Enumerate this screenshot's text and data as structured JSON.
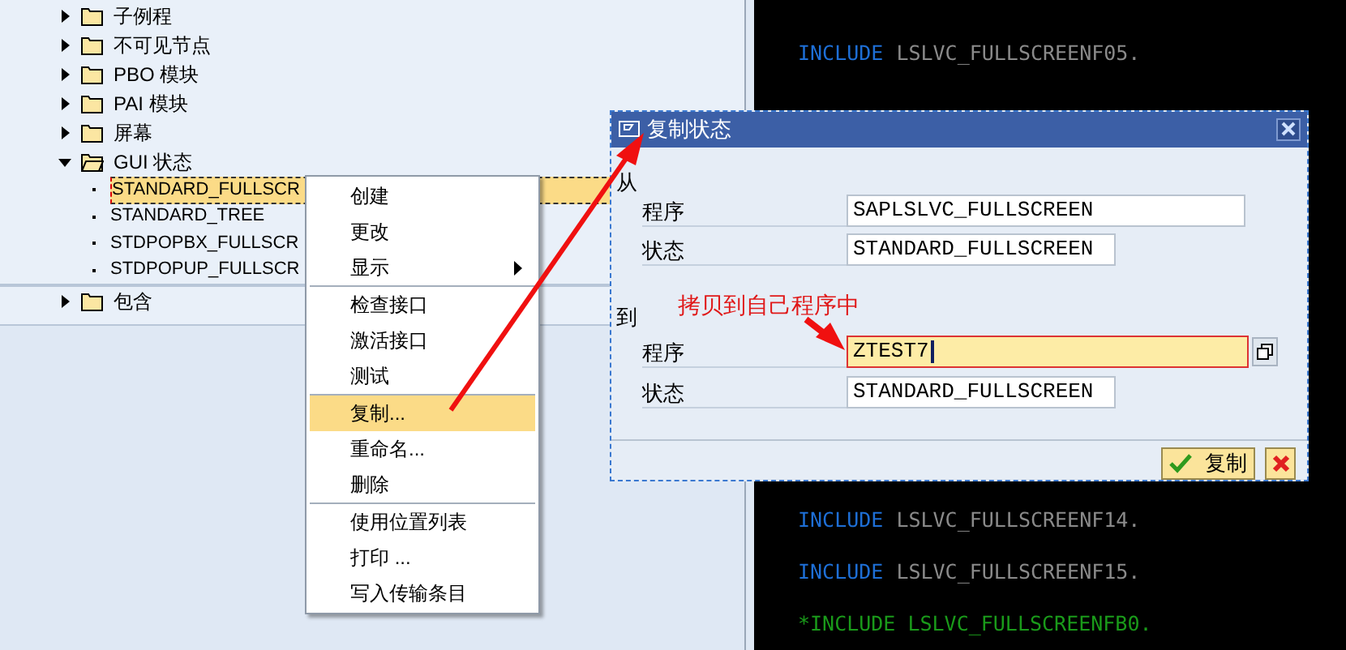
{
  "tree": {
    "items": [
      {
        "label": "子例程",
        "expanded": false
      },
      {
        "label": "不可见节点",
        "expanded": false
      },
      {
        "label": "PBO 模块",
        "expanded": false
      },
      {
        "label": "PAI 模块",
        "expanded": false
      },
      {
        "label": "屏幕",
        "expanded": false
      },
      {
        "label": "GUI 状态",
        "expanded": true,
        "children": [
          {
            "label": "STANDARD_FULLSCR",
            "selected": true
          },
          {
            "label": "STANDARD_TREE",
            "selected": false
          },
          {
            "label": "STDPOPBX_FULLSCR",
            "selected": false
          },
          {
            "label": "STDPOPUP_FULLSCR",
            "selected": false
          }
        ]
      },
      {
        "label": "包含",
        "expanded": false
      }
    ]
  },
  "context_menu": {
    "groups": [
      [
        {
          "label": "创建",
          "selected": false,
          "submenu": false
        },
        {
          "label": "更改",
          "selected": false,
          "submenu": false
        },
        {
          "label": "显示",
          "selected": false,
          "submenu": true
        }
      ],
      [
        {
          "label": "检查接口",
          "selected": false,
          "submenu": false
        },
        {
          "label": "激活接口",
          "selected": false,
          "submenu": false
        },
        {
          "label": "测试",
          "selected": false,
          "submenu": false
        }
      ],
      [
        {
          "label": "复制...",
          "selected": true,
          "submenu": false
        },
        {
          "label": "重命名...",
          "selected": false,
          "submenu": false
        },
        {
          "label": "删除",
          "selected": false,
          "submenu": false
        }
      ],
      [
        {
          "label": "使用位置列表",
          "selected": false,
          "submenu": false
        },
        {
          "label": "打印 ...",
          "selected": false,
          "submenu": false
        },
        {
          "label": "写入传输条目",
          "selected": false,
          "submenu": false
        }
      ]
    ]
  },
  "editor": {
    "lines_top": [
      {
        "kind": "code",
        "keyword": "INCLUDE",
        "rest": "LSLVC_FULLSCREENF05."
      }
    ],
    "lines_bottom": [
      {
        "kind": "code",
        "keyword": "INCLUDE",
        "rest": "LSLVC_FULLSCREENF14."
      },
      {
        "kind": "code",
        "keyword": "INCLUDE",
        "rest": "LSLVC_FULLSCREENF15."
      },
      {
        "kind": "comment",
        "text": "*INCLUDE LSLVC_FULLSCREENFB0."
      }
    ]
  },
  "dialog": {
    "title": "复制状态",
    "from": {
      "label": "从",
      "fields": [
        {
          "label": "程序",
          "value": "SAPLSLVC_FULLSCREEN",
          "focused": false
        },
        {
          "label": "状态",
          "value": "STANDARD_FULLSCREEN",
          "focused": false
        }
      ]
    },
    "to": {
      "label": "到",
      "fields": [
        {
          "label": "程序",
          "value": "ZTEST7",
          "focused": true
        },
        {
          "label": "状态",
          "value": "STANDARD_FULLSCREEN",
          "focused": false
        }
      ]
    },
    "buttons": {
      "confirm": "复制"
    }
  },
  "annotation": "拷贝到自己程序中"
}
